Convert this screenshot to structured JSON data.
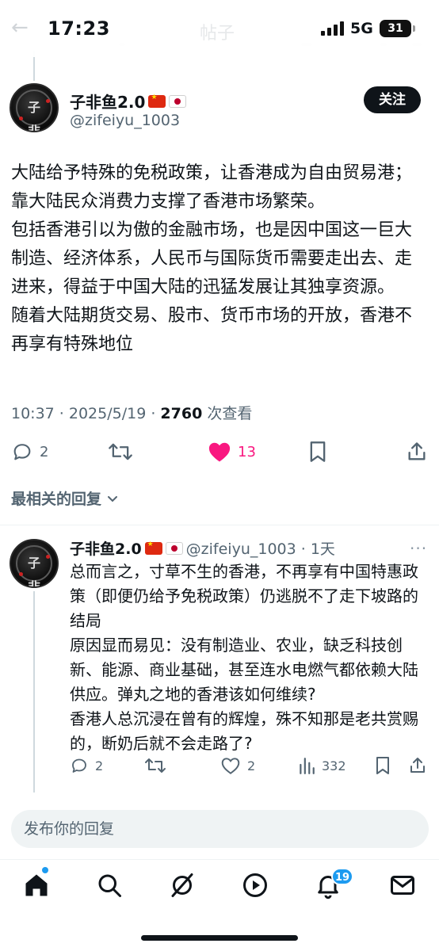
{
  "status_bar": {
    "time": "17:23",
    "network": "5G",
    "battery": "31"
  },
  "header": {
    "title_ghost": "帖子"
  },
  "main_post": {
    "display_name": "子非鱼2.0",
    "handle": "@zifeiyu_1003",
    "follow_label": "关注",
    "text_lines": [
      "大陆给予特殊的免税政策，让香港成为自由贸易港；靠大陆民众消费力支撑了香港市场繁荣。",
      "包括香港引以为傲的金融市场，也是因中国这一巨大制造、经济体系，人民币与国际货币需要走出去、走进来，得益于中国大陆的迅猛发展让其独享资源。",
      "随着大陆期货交易、股市、货币市场的开放，香港不再享有特殊地位"
    ],
    "timestamp": "10:37 · 2025/5/19 · ",
    "views_count": "2760",
    "views_label": " 次查看",
    "replies": "2",
    "likes": "13",
    "liked": true
  },
  "sort": {
    "label": "最相关的回复"
  },
  "reply": {
    "display_name": "子非鱼2.0",
    "handle_time": "@zifeiyu_1003 · 1天",
    "text_lines": [
      "总而言之，寸草不生的香港，不再享有中国特惠政策（即便仍给予免税政策）仍逃脱不了走下坡路的结局",
      "原因显而易见：没有制造业、农业，缺乏科技创新、能源、商业基础，甚至连水电燃气都依赖大陆供应。弹丸之地的香港该如何维续?",
      "香港人总沉浸在曾有的辉煌，殊不知那是老共赏赐的，断奶后就不会走路了?"
    ],
    "replies": "2",
    "likes": "2",
    "views": "332"
  },
  "reply_box": {
    "placeholder": "发布你的回复"
  },
  "bottom_nav": {
    "notifications_badge": "19"
  },
  "colors": {
    "like_pink": "#f91880",
    "accent_blue": "#1d9bf0",
    "secondary_text": "#536471"
  }
}
